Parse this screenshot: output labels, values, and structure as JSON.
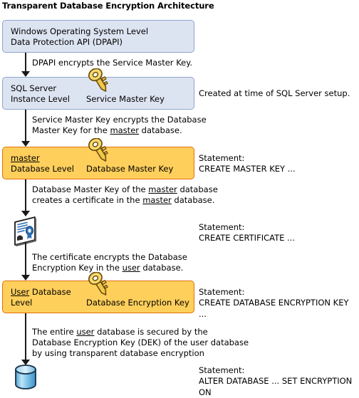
{
  "title": "Transparent Database Encryption Architecture",
  "colors": {
    "blue_fill": "#dde4f1",
    "blue_border": "#8fa4cc",
    "orange_fill": "#ffcf5c",
    "orange_border": "#e0720c",
    "connector": "#1a1a1a",
    "key_body": "#f2c84b",
    "key_outline": "#7a5a12",
    "cert_accent": "#2a6fb5",
    "db_fill": "#7ec2e8"
  },
  "levels": [
    {
      "id": "windows-os-level",
      "left_line1": "Windows Operating System Level",
      "left_line2": "Data Protection API (DPAPI)",
      "center_label": "",
      "style": "blue"
    },
    {
      "id": "sql-server-instance-level",
      "left_line1": "SQL Server",
      "left_line2": "Instance Level",
      "center_label": "Service Master Key",
      "style": "blue"
    },
    {
      "id": "master-database-level",
      "left_line1": "master",
      "left_line2": "Database Level",
      "center_label": "Database Master Key",
      "style": "orange"
    },
    {
      "id": "user-database-level",
      "left_line1_a": "User",
      "left_line1_b": " Database",
      "left_line2": "Level",
      "center_label": "Database Encryption Key",
      "style": "orange"
    }
  ],
  "notes": {
    "dpapi_encrypts": "DPAPI encrypts the Service Master Key.",
    "smk_encrypts_dmk_l1": "Service Master Key encrypts the Database",
    "smk_encrypts_dmk_l2_a": "Master Key for the ",
    "smk_encrypts_dmk_l2_b": "master",
    "smk_encrypts_dmk_l2_c": " database.",
    "dmk_creates_cert_l1_a": "Database Master Key of the ",
    "dmk_creates_cert_l1_b": "master",
    "dmk_creates_cert_l1_c": " database",
    "dmk_creates_cert_l2_a": "creates a certificate in the ",
    "dmk_creates_cert_l2_b": "master",
    "dmk_creates_cert_l2_c": " database.",
    "cert_encrypts_dek_l1": "The certificate encrypts the Database",
    "cert_encrypts_dek_l2_a": "Encryption Key in the ",
    "cert_encrypts_dek_l2_b": "user",
    "cert_encrypts_dek_l2_c": " database.",
    "entire_db_l1_a": "The entire ",
    "entire_db_l1_b": "user",
    "entire_db_l1_c": " database is secured by the",
    "entire_db_l2": "Database Encryption Key (DEK) of the user database",
    "entire_db_l3": "by using transparent database encryption"
  },
  "statements": {
    "label": "Statement:",
    "sql_server_setup_note": "Created at time of SQL Server setup.",
    "create_master_key": "CREATE MASTER KEY ...",
    "create_certificate": "CREATE CERTIFICATE ...",
    "create_database_encryption_key": "CREATE DATABASE ENCRYPTION KEY ...",
    "alter_database": "ALTER DATABASE ... SET ENCRYPTION ON"
  },
  "icons": {
    "service_master_key": "key-icon",
    "database_master_key": "key-icon",
    "database_encryption_key": "key-icon",
    "certificate": "certificate-icon",
    "user_database": "database-cylinder-icon"
  }
}
